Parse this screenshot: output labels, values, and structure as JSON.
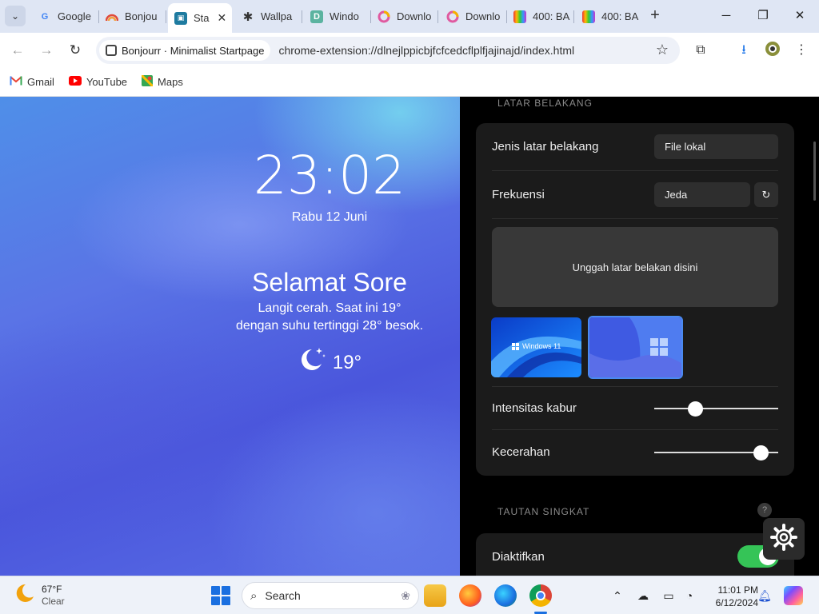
{
  "browser": {
    "tabs": [
      {
        "label": "Google",
        "favicon": "google-icon"
      },
      {
        "label": "Bonjou",
        "favicon": "rainbow-icon"
      },
      {
        "label": "Sta",
        "favicon": "startpage-icon",
        "active": true
      },
      {
        "label": "Wallpa",
        "favicon": "star-icon"
      },
      {
        "label": "Windo",
        "favicon": "d-icon"
      },
      {
        "label": "Downlo",
        "favicon": "ring-icon"
      },
      {
        "label": "Downlo",
        "favicon": "ring-icon"
      },
      {
        "label": "400: BA",
        "favicon": "tv-icon"
      },
      {
        "label": "400: BA",
        "favicon": "tv-icon"
      }
    ],
    "omnibox": {
      "chip": "Bonjourr · Minimalist Startpage",
      "url": "chrome-extension://dlnejlppicbjfcfcedcflplfjajinajd/index.html"
    },
    "bookmarks": [
      {
        "label": "Gmail",
        "color": "#ea4335"
      },
      {
        "label": "YouTube",
        "color": "#ff0000"
      },
      {
        "label": "Maps",
        "color": "#34a853"
      }
    ]
  },
  "startpage": {
    "clock": "23:02",
    "date": "Rabu 12 Juni",
    "greeting": "Selamat Sore",
    "weather_line1": "Langit cerah. Saat ini 19°",
    "weather_line2": "dengan suhu tertinggi 28° besok.",
    "temperature": "19°"
  },
  "settings": {
    "background_section": "LATAR BELAKANG",
    "bg_type_label": "Jenis latar belakang",
    "bg_type_value": "File lokal",
    "frequency_label": "Frekuensi",
    "frequency_value": "Jeda",
    "upload_text": "Unggah latar belakan disini",
    "thumb1_caption": "Windows 11",
    "blur_label": "Intensitas kabur",
    "blur_value": 0.33,
    "brightness_label": "Kecerahan",
    "brightness_value": 0.86,
    "links_section": "TAUTAN SINGKAT",
    "enabled_label": "Diaktifkan",
    "enabled": true
  },
  "taskbar": {
    "weather_temp": "67°F",
    "weather_cond": "Clear",
    "search_placeholder": "Search",
    "time": "11:01 PM",
    "date": "6/12/2024"
  }
}
